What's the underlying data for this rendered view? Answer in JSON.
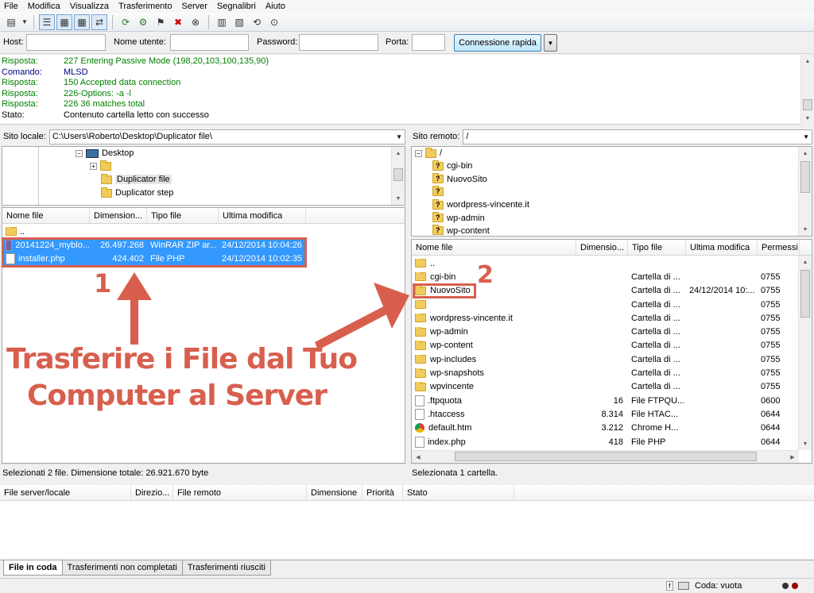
{
  "menu": [
    "File",
    "Modifica",
    "Visualizza",
    "Trasferimento",
    "Server",
    "Segnalibri",
    "Aiuto"
  ],
  "quickconnect": {
    "host_label": "Host:",
    "user_label": "Nome utente:",
    "password_label": "Password:",
    "port_label": "Porta:",
    "connect_button": "Connessione rapida"
  },
  "log": [
    {
      "key": "Risposta:",
      "msg": "227 Entering Passive Mode (198,20,103,100,135,90)",
      "color": "#008000"
    },
    {
      "key": "Comando:",
      "msg": "MLSD",
      "color": "#000080"
    },
    {
      "key": "Risposta:",
      "msg": "150 Accepted data connection",
      "color": "#008000"
    },
    {
      "key": "Risposta:",
      "msg": "226-Options: -a -l",
      "color": "#008000"
    },
    {
      "key": "Risposta:",
      "msg": "226 36 matches total",
      "color": "#008000"
    },
    {
      "key": "Stato:",
      "msg": "Contenuto cartella letto con successo",
      "color": "#000000"
    }
  ],
  "local": {
    "site_label": "Sito locale:",
    "path": "C:\\Users\\Roberto\\Desktop\\Duplicator file\\",
    "tree": [
      "Desktop",
      "",
      "Duplicator file",
      "Duplicator step"
    ],
    "columns": [
      "Nome file",
      "Dimension...",
      "Tipo file",
      "Ultima modifica"
    ],
    "files": [
      {
        "name": "..",
        "size": "",
        "type": "",
        "modified": ""
      },
      {
        "name": "20141224_myblo...",
        "size": "26.497.268",
        "type": "WinRAR ZIP ar...",
        "modified": "24/12/2014 10:04:26"
      },
      {
        "name": "installer.php",
        "size": "424.402",
        "type": "File PHP",
        "modified": "24/12/2014 10:02:35"
      }
    ],
    "status": "Selezionati 2 file. Dimensione totale: 26.921.670 byte"
  },
  "remote": {
    "site_label": "Sito remoto:",
    "path": "/",
    "tree": [
      "/",
      "cgi-bin",
      "NuovoSito",
      "",
      "wordpress-vincente.it",
      "wp-admin",
      "wp-content"
    ],
    "columns": [
      "Nome file",
      "Dimensio...",
      "Tipo file",
      "Ultima modifica",
      "Permessi"
    ],
    "files": [
      {
        "name": "..",
        "size": "",
        "type": "",
        "modified": "",
        "perm": ""
      },
      {
        "name": "cgi-bin",
        "size": "",
        "type": "Cartella di ...",
        "modified": "",
        "perm": "0755"
      },
      {
        "name": "NuovoSito",
        "size": "",
        "type": "Cartella di ...",
        "modified": "24/12/2014 10:...",
        "perm": "0755"
      },
      {
        "name": "",
        "size": "",
        "type": "Cartella di ...",
        "modified": "",
        "perm": "0755"
      },
      {
        "name": "wordpress-vincente.it",
        "size": "",
        "type": "Cartella di ...",
        "modified": "",
        "perm": "0755"
      },
      {
        "name": "wp-admin",
        "size": "",
        "type": "Cartella di ...",
        "modified": "",
        "perm": "0755"
      },
      {
        "name": "wp-content",
        "size": "",
        "type": "Cartella di ...",
        "modified": "",
        "perm": "0755"
      },
      {
        "name": "wp-includes",
        "size": "",
        "type": "Cartella di ...",
        "modified": "",
        "perm": "0755"
      },
      {
        "name": "wp-snapshots",
        "size": "",
        "type": "Cartella di ...",
        "modified": "",
        "perm": "0755"
      },
      {
        "name": "wpvincente",
        "size": "",
        "type": "Cartella di ...",
        "modified": "",
        "perm": "0755"
      },
      {
        "name": ".ftpquota",
        "size": "16",
        "type": "File FTPQU...",
        "modified": "",
        "perm": "0600"
      },
      {
        "name": ".htaccess",
        "size": "8.314",
        "type": "File HTAC...",
        "modified": "",
        "perm": "0644"
      },
      {
        "name": "default.htm",
        "size": "3.212",
        "type": "Chrome H...",
        "modified": "",
        "perm": "0644"
      },
      {
        "name": "index.php",
        "size": "418",
        "type": "File PHP",
        "modified": "",
        "perm": "0644"
      }
    ],
    "status": "Selezionata 1 cartella."
  },
  "queue": {
    "columns": [
      "File server/locale",
      "Direzio...",
      "File remoto",
      "Dimensione",
      "Priorità",
      "Stato"
    ],
    "tabs": [
      "File in coda",
      "Trasferimenti non completati",
      "Trasferimenti riusciti"
    ],
    "status": "Coda: vuota"
  },
  "annotations": {
    "label1": "1",
    "label2": "2",
    "caption_line1": "Trasferire i File dal Tuo",
    "caption_line2": "Computer al Server",
    "color": "#d85f4e"
  },
  "colors": {
    "selection": "#3399ff",
    "selection_text": "#ffffff"
  }
}
